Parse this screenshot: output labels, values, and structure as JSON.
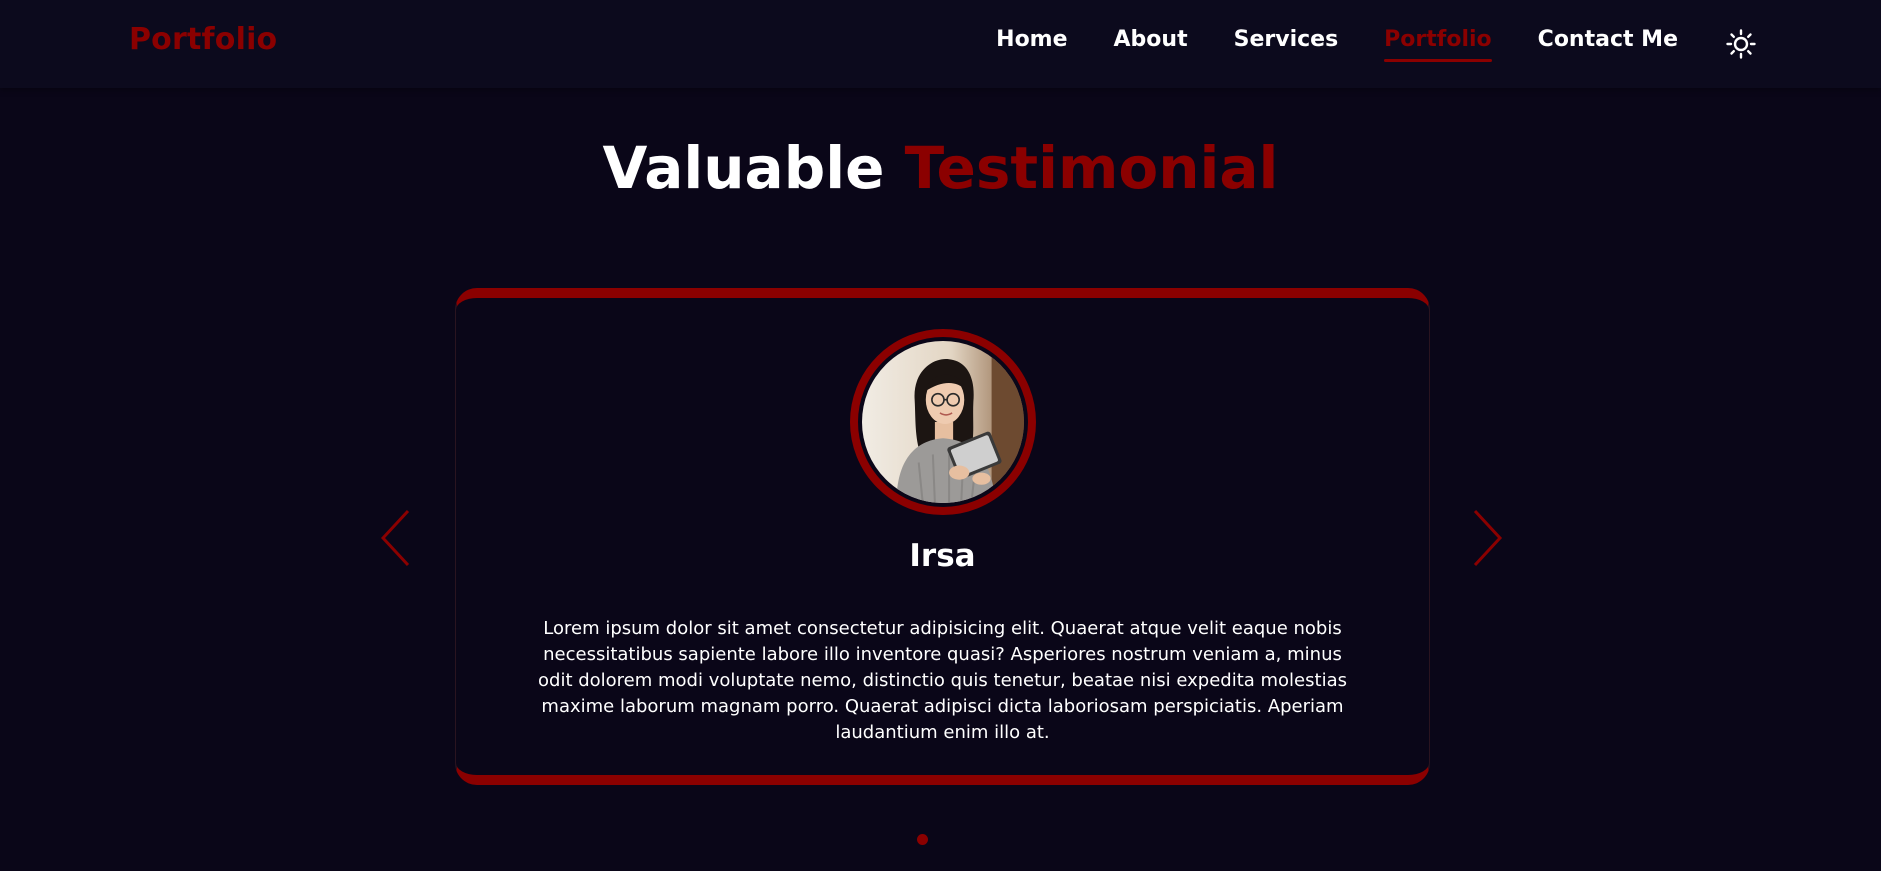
{
  "nav": {
    "logo": "Portfolio",
    "links": [
      {
        "label": "Home",
        "active": false
      },
      {
        "label": "About",
        "active": false
      },
      {
        "label": "Services",
        "active": false
      },
      {
        "label": "Portfolio",
        "active": true
      },
      {
        "label": "Contact Me",
        "active": false
      }
    ],
    "theme_icon": "sun-icon"
  },
  "section": {
    "title_plain": "Valuable",
    "title_accent": "Testimonial"
  },
  "testimonial": {
    "name": "Irsa",
    "text": "Lorem ipsum dolor sit amet consectetur adipisicing elit. Quaerat atque velit eaque nobis necessitatibus sapiente labore illo inventore quasi? Asperiores nostrum veniam a, minus odit dolorem modi voluptate nemo, distinctio quis tenetur, beatae nisi expedita molestias maxime laborum magnam porro. Quaerat adipisci dicta laboriosam perspiciatis. Aperiam laudantium enim illo at.",
    "avatar_icon": "avatar-photo"
  },
  "carousel": {
    "prev_icon": "chevron-left-icon",
    "next_icon": "chevron-right-icon",
    "total_slides": 1,
    "current_slide": 1
  },
  "colors": {
    "background": "#0a0618",
    "navbar": "#0c0a1d",
    "accent": "#8b0000",
    "text": "#ffffff"
  }
}
